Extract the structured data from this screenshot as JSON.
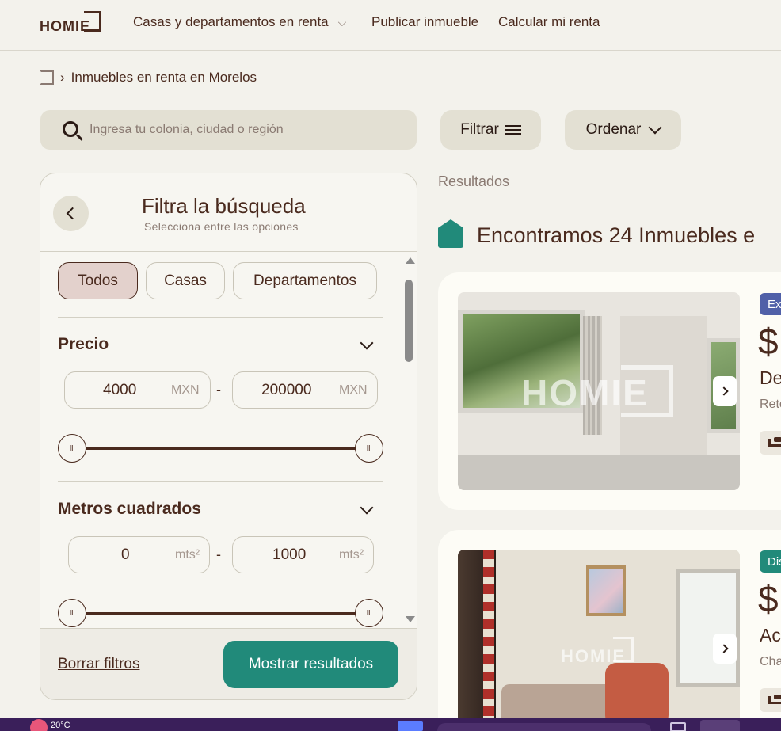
{
  "header": {
    "logo_text": "HOMIE",
    "nav_casas": "Casas y departamentos en renta",
    "nav_publicar": "Publicar inmueble",
    "nav_calcular": "Calcular mi renta"
  },
  "breadcrumb": {
    "current": "Inmuebles en renta en Morelos"
  },
  "search": {
    "placeholder": "Ingresa tu colonia, ciudad o región"
  },
  "toolbar": {
    "filter_label": "Filtrar",
    "sort_label": "Ordenar"
  },
  "filters": {
    "title": "Filtra la búsqueda",
    "subtitle": "Selecciona entre las opciones",
    "types": [
      "Todos",
      "Casas",
      "Departamentos"
    ],
    "selected_type": "Todos",
    "price": {
      "title": "Precio",
      "min": "4000",
      "max": "200000",
      "unit": "MXN"
    },
    "area": {
      "title": "Metros cuadrados",
      "min": "0",
      "max": "1000",
      "unit": "mts²"
    },
    "handle_glyph": "III",
    "range_separator": "-",
    "clear_label": "Borrar filtros",
    "show_label": "Mostrar resultados"
  },
  "results": {
    "label": "Resultados",
    "title": "Encontramos 24 Inmuebles e",
    "cards": [
      {
        "tag": "Ex",
        "price": "$",
        "title": "De",
        "location": "Reto",
        "watermark": "HOMIE"
      },
      {
        "tag": "Dis",
        "price": "$",
        "title": "Ac",
        "location": "Cha",
        "watermark": "HOMIE"
      }
    ]
  },
  "taskbar": {
    "temperature": "20°C"
  },
  "colors": {
    "accent": "#218a7a",
    "text": "#4a2a1e",
    "background": "#f3f2ec",
    "tag_blue": "#5060a8"
  }
}
